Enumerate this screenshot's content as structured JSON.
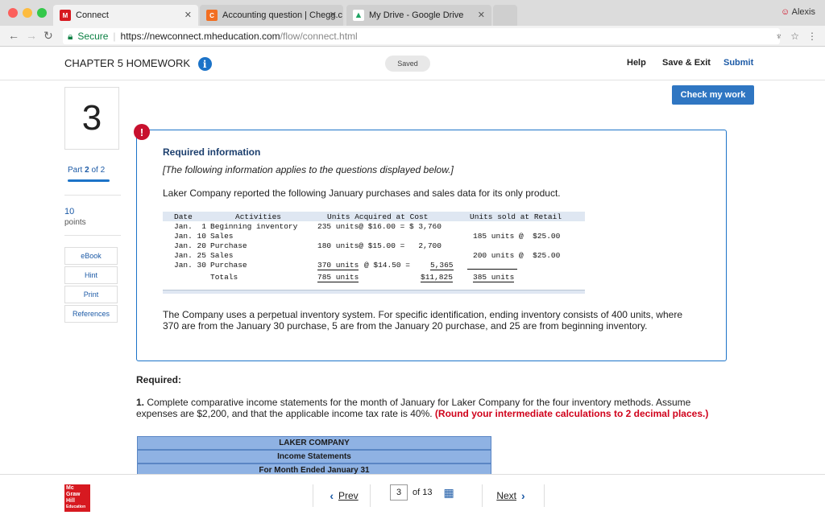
{
  "browser": {
    "tabs": [
      {
        "label": "Connect",
        "icon": "mcgraw-hill-favicon"
      },
      {
        "label": "Accounting question | Chegg.c",
        "icon": "chegg-favicon"
      },
      {
        "label": "My Drive - Google Drive",
        "icon": "google-drive-favicon"
      }
    ],
    "profile": "Alexis",
    "secure_label": "Secure",
    "url_host": "https://newconnect.mheducation.com",
    "url_path": "/flow/connect.html"
  },
  "header": {
    "chapter_title": "CHAPTER 5 HOMEWORK",
    "saved_label": "Saved",
    "help": "Help",
    "save_exit": "Save & Exit",
    "submit": "Submit"
  },
  "check_my_work": "Check my work",
  "question": {
    "number": "3",
    "part_prefix": "Part ",
    "part_num": "2",
    "part_suffix": " of 2",
    "points_value": "10",
    "points_label": "points"
  },
  "rail_buttons": [
    "eBook",
    "Hint",
    "Print",
    "References"
  ],
  "info": {
    "heading": "Required information",
    "applies": "[The following information applies to the questions displayed below.]",
    "intro": "Laker Company reported the following January purchases and sales data for its only product."
  },
  "table": {
    "headers": {
      "date": "Date",
      "activities": "Activities",
      "acquired": "Units Acquired at Cost",
      "sold": "Units sold at Retail"
    },
    "rows": [
      {
        "date": "Jan.  1",
        "activity": "Beginning inventory",
        "acquired": "235 units@ $16.00 = $ 3,760",
        "sold": ""
      },
      {
        "date": "Jan. 10",
        "activity": "Sales",
        "acquired": "",
        "sold": "185 units @  $25.00"
      },
      {
        "date": "Jan. 20",
        "activity": "Purchase",
        "acquired": "180 units@ $15.00 =   2,700",
        "sold": ""
      },
      {
        "date": "Jan. 25",
        "activity": "Sales",
        "acquired": "",
        "sold": "200 units @  $25.00"
      },
      {
        "date": "Jan. 30",
        "activity": "Purchase",
        "acquired_units": "370 units",
        "acquired_rate": "@ $14.50 =",
        "acquired_total": "5,365",
        "sold": ""
      }
    ],
    "totals_label": "Totals",
    "total_units": "785 units",
    "total_cost": "$11,825",
    "total_sold": "385 units"
  },
  "para2": "The Company uses a perpetual inventory system. For specific identification, ending inventory consists of 400 units, where 370 are from the January 30 purchase, 5 are from the January 20 purchase, and 25 are from beginning inventory.",
  "required_heading": "Required:",
  "q1": {
    "num": "1.",
    "text": " Complete comparative income statements for the month of January for Laker Company for the four inventory methods. Assume expenses are $2,200, and that the applicable income tax rate is 40%. ",
    "red": "(Round your intermediate calculations to 2 decimal places.)"
  },
  "statement_header": [
    "LAKER COMPANY",
    "Income Statements",
    "For Month Ended January 31"
  ],
  "footer": {
    "logo_lines": [
      "Mc",
      "Graw",
      "Hill",
      "Education"
    ],
    "prev": "Prev",
    "page": "3",
    "of": "of 13",
    "next": "Next"
  },
  "colors": {
    "accent": "#1c73c8",
    "alert": "#c8102e",
    "header_fill": "#8fb2e3"
  }
}
